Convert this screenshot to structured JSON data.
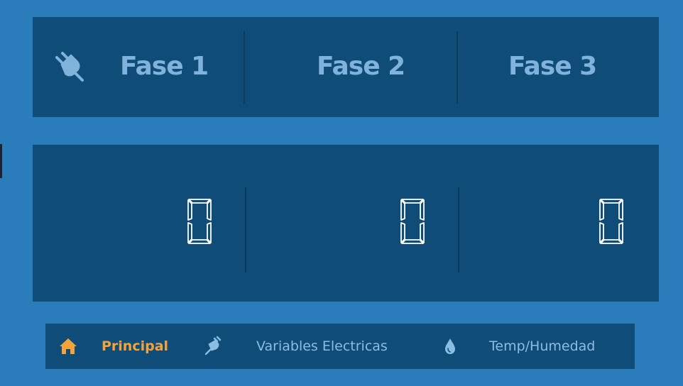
{
  "header": {
    "plug_icon": "plug-icon",
    "phases": [
      "Fase 1",
      "Fase 2",
      "Fase 3"
    ]
  },
  "readings": {
    "values": [
      "0",
      "0",
      "0"
    ]
  },
  "nav": {
    "items": [
      {
        "label": "Principal",
        "icon": "home-icon",
        "active": true
      },
      {
        "label": "Variables Electricas",
        "icon": "plug-icon",
        "active": false
      },
      {
        "label": "Temp/Humedad",
        "icon": "water-drop-icon",
        "active": false
      }
    ]
  },
  "colors": {
    "background": "#2a7dba",
    "panel": "#0f4d78",
    "title": "#7fb3dc",
    "active": "#f4a23c",
    "nav_text": "#8bbde3",
    "digits": "#ffffff"
  }
}
